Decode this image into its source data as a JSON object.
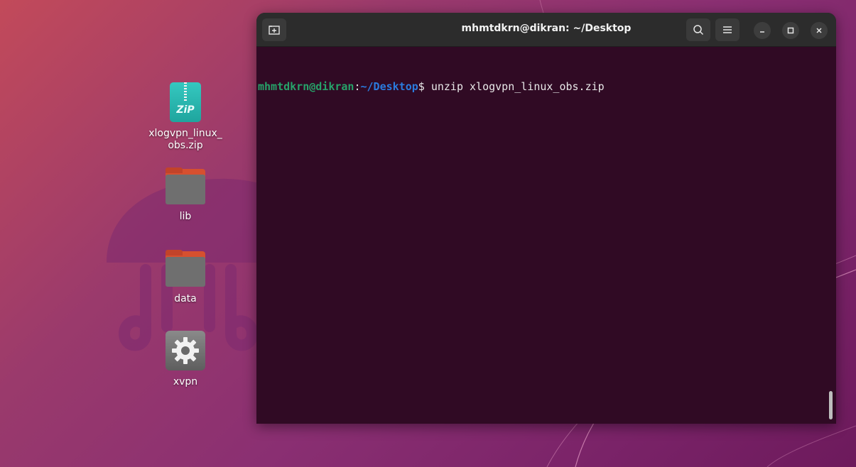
{
  "desktop": {
    "icons": [
      {
        "label": "xlogvpn_linux_\nobs.zip",
        "type": "zip",
        "icon_text": "ZiP"
      },
      {
        "label": "lib",
        "type": "folder"
      },
      {
        "label": "data",
        "type": "folder"
      },
      {
        "label": "xvpn",
        "type": "executable"
      }
    ]
  },
  "terminal": {
    "title": "mhmtdkrn@dikran: ~/Desktop",
    "prompt": {
      "user_host": "mhmtdkrn@dikran",
      "colon": ":",
      "path": "~/Desktop",
      "symbol": "$ ",
      "command": "unzip xlogvpn_linux_obs.zip"
    },
    "buttons": {
      "new_tab": "new-tab-icon",
      "search": "search-icon",
      "menu": "hamburger-menu-icon",
      "minimize": "minimize-icon",
      "maximize": "maximize-icon",
      "close": "close-icon"
    }
  },
  "colors": {
    "terminal_bg": "#300a24",
    "prompt_user": "#26a269",
    "prompt_path": "#2a7bde",
    "zip_icon": "#1fa59e",
    "folder_accent": "#d6502f"
  }
}
